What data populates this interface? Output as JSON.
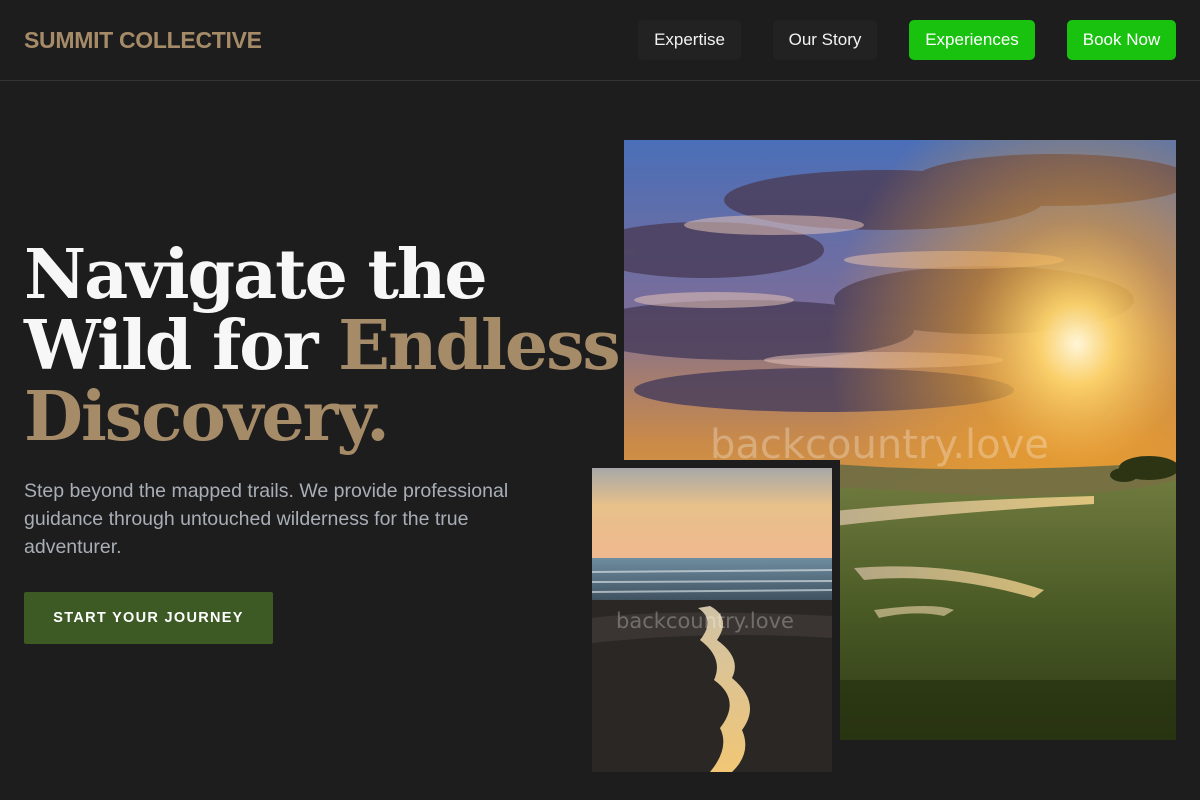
{
  "brand": {
    "name": "SUMMIT COLLECTIVE"
  },
  "nav": {
    "items": [
      {
        "label": "Expertise"
      },
      {
        "label": "Our Story"
      },
      {
        "label": "Experiences"
      }
    ],
    "cta_label": "Book Now"
  },
  "hero": {
    "headline_line1": "Navigate the",
    "headline_line2_plain": "Wild for ",
    "headline_line2_accent": "Endless",
    "headline_line3_accent": "Discovery.",
    "subtext": "Step beyond the mapped trails. We provide professional guidance through untouched wilderness for the true adventurer.",
    "cta_label": "START YOUR JOURNEY"
  },
  "images": {
    "main_watermark": "backcountry.love",
    "small_watermark": "backcountry.love"
  },
  "colors": {
    "background": "#1d1d1d",
    "accent_tan": "#a68b68",
    "nav_green": "#18c20f",
    "cta_green": "#3d5a24",
    "subtext_gray": "#a9aeb6"
  }
}
